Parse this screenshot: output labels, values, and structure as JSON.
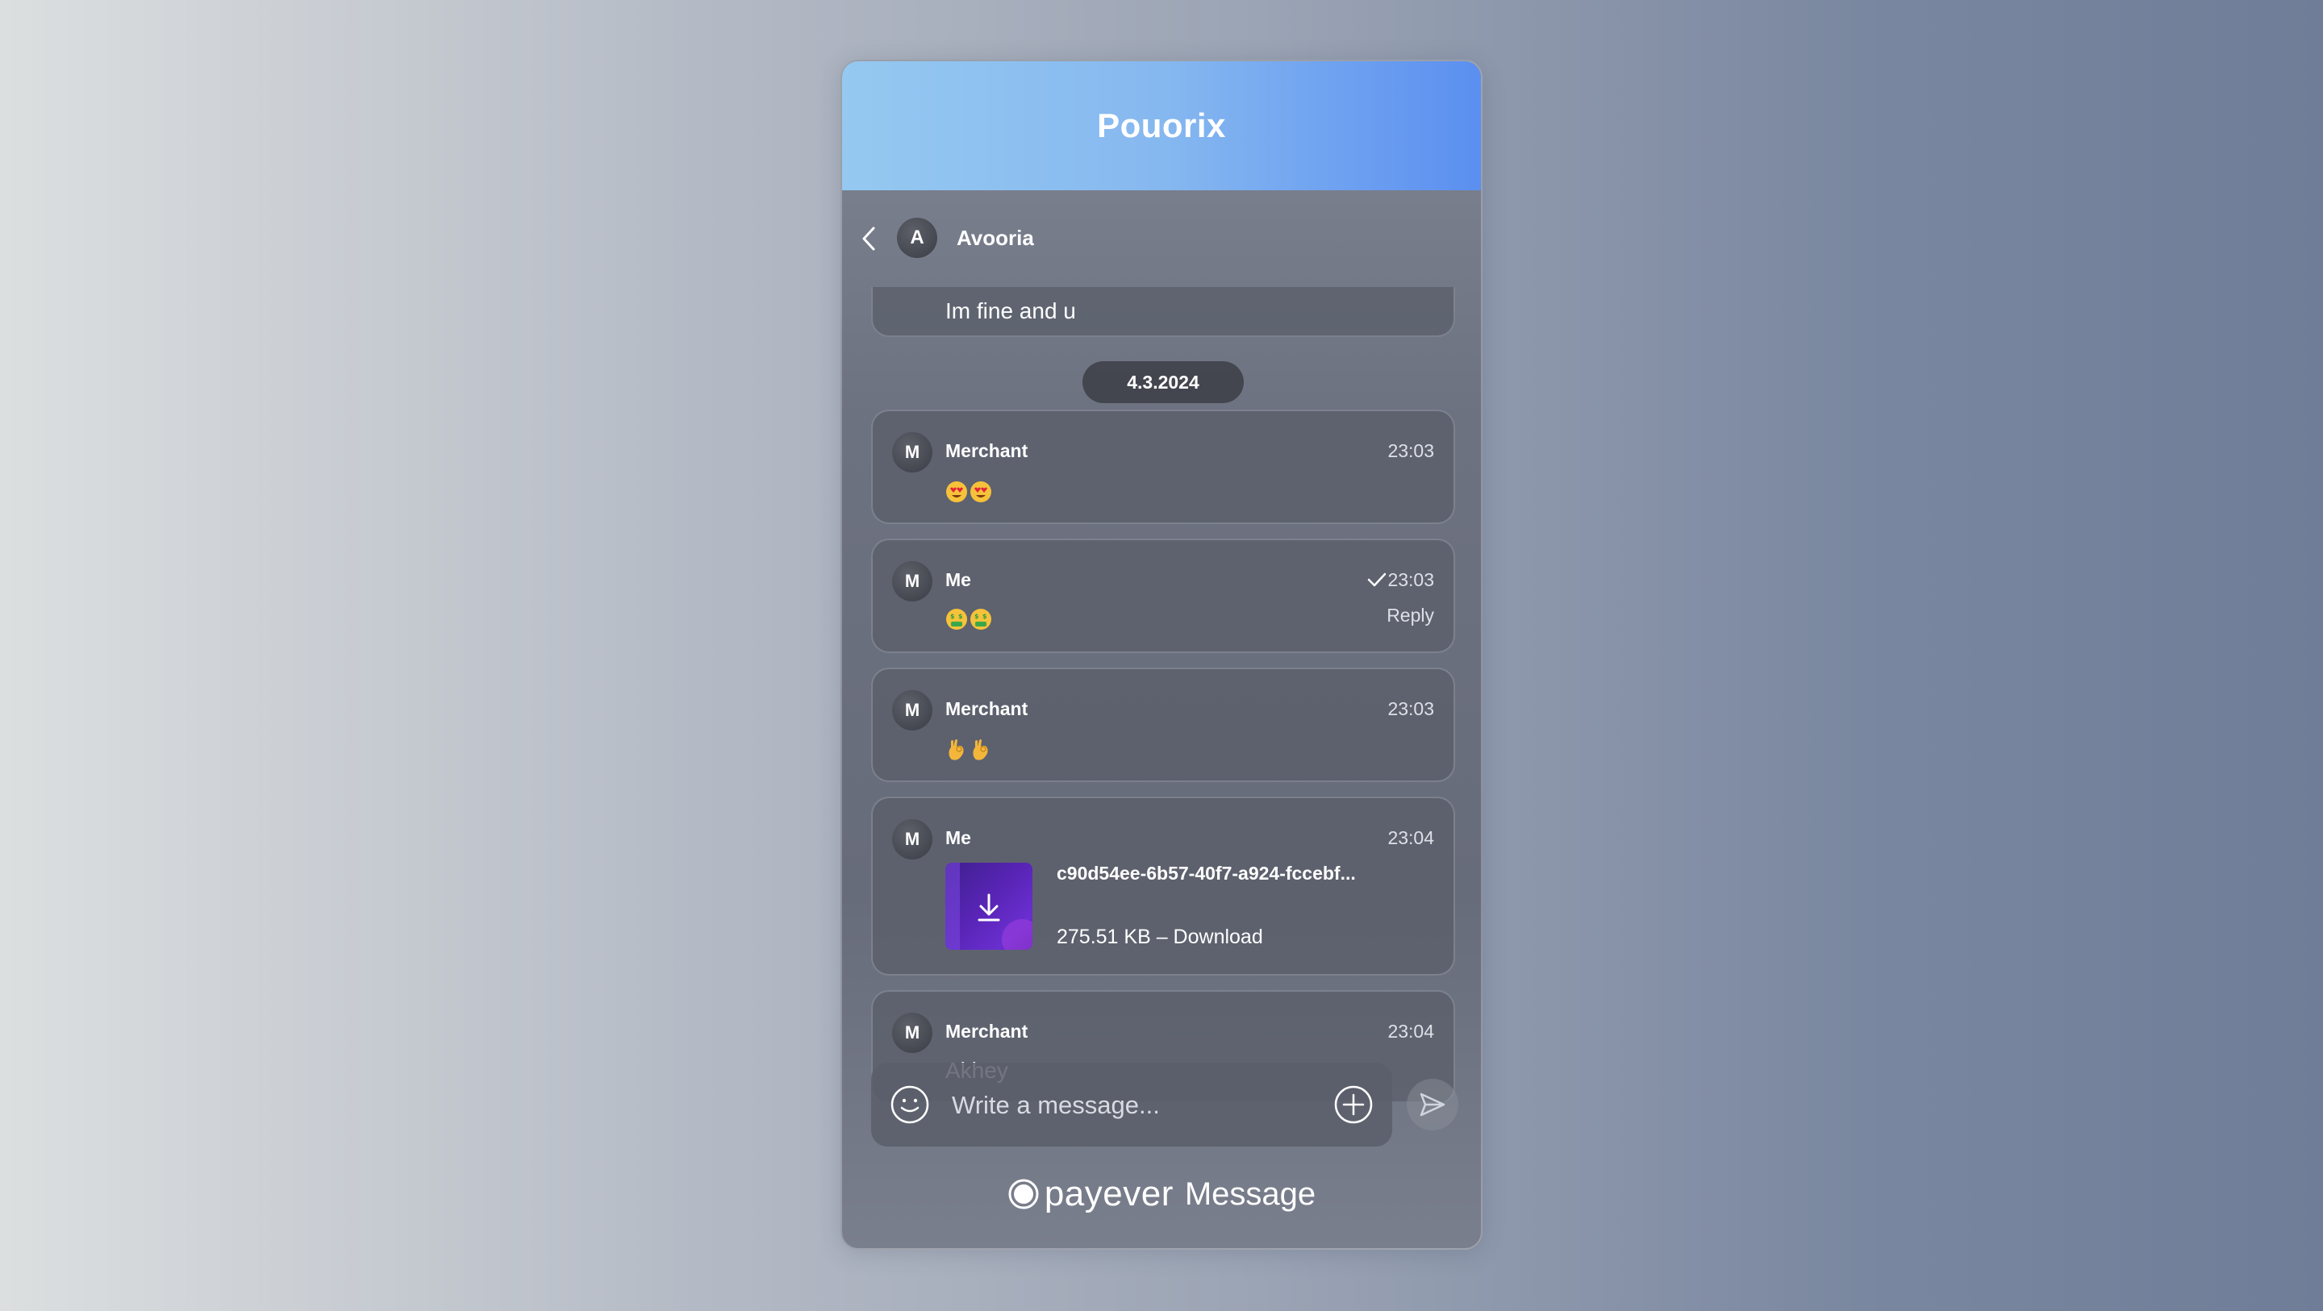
{
  "header": {
    "title": "Pouorix"
  },
  "conversation": {
    "avatar_letter": "A",
    "name": "Avooria"
  },
  "date_pill": "4.3.2024",
  "partial_message": {
    "text": "Im fine and u"
  },
  "messages": [
    {
      "avatar": "M",
      "author": "Merchant",
      "time": "23:03",
      "emojis": [
        "smiling-face-with-heart-eyes",
        "smiling-face-with-heart-eyes"
      ]
    },
    {
      "avatar": "M",
      "author": "Me",
      "time": "23:03",
      "read": true,
      "reply_label": "Reply",
      "emojis": [
        "money-mouth-face",
        "money-mouth-face"
      ]
    },
    {
      "avatar": "M",
      "author": "Merchant",
      "time": "23:03",
      "emojis": [
        "ok-hand",
        "ok-hand"
      ]
    },
    {
      "avatar": "M",
      "author": "Me",
      "time": "23:04",
      "file": {
        "name": "c90d54ee-6b57-40f7-a924-fccebf...",
        "meta": "275.51 KB – Download"
      }
    },
    {
      "avatar": "M",
      "author": "Merchant",
      "time": "23:04",
      "text": "Akhey"
    }
  ],
  "composer": {
    "placeholder": "Write a message..."
  },
  "footer": {
    "brand": "payever",
    "suffix": "Message"
  },
  "colors": {
    "header_gradient_start": "#95c9f0",
    "header_gradient_end": "#5b8ff0",
    "bubble": "#5a5e6a",
    "file_thumb": "#5a25b8"
  }
}
